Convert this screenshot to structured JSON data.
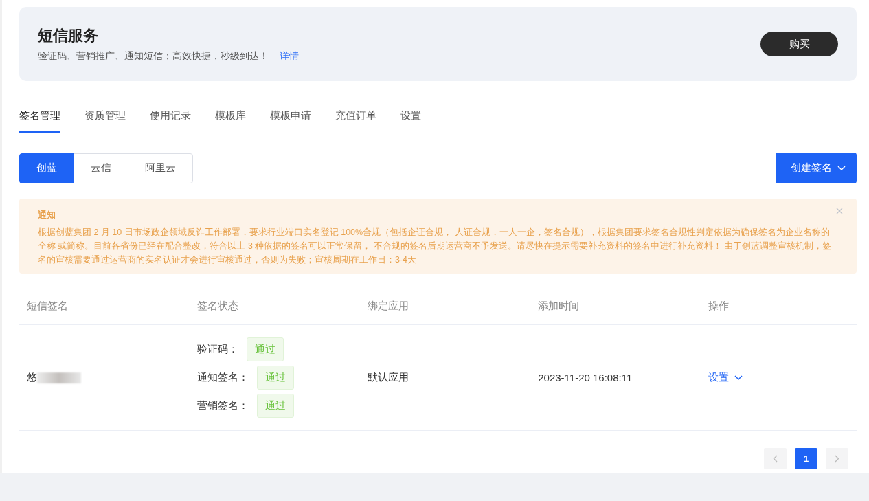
{
  "header": {
    "title": "短信服务",
    "subtitle": "验证码、营销推广、通知短信；高效快捷，秒级到达！",
    "link": "详情",
    "buy_button": "购买"
  },
  "tabs": [
    {
      "label": "签名管理",
      "selected": true
    },
    {
      "label": "资质管理",
      "selected": false
    },
    {
      "label": "使用记录",
      "selected": false
    },
    {
      "label": "模板库",
      "selected": false
    },
    {
      "label": "模板申请",
      "selected": false
    },
    {
      "label": "充值订单",
      "selected": false
    },
    {
      "label": "设置",
      "selected": false
    }
  ],
  "providers": [
    {
      "label": "创蓝",
      "selected": true
    },
    {
      "label": "云信",
      "selected": false
    },
    {
      "label": "阿里云",
      "selected": false
    }
  ],
  "create_button": "创建签名",
  "notice": {
    "title": "通知",
    "text": "根据创蓝集团 2 月 10 日市场政企领域反诈工作部署，要求行业端口实名登记 100%合规（包括企证合规， 人证合规，一人一企，签名合规），根据集团要求签名合规性判定依据为确保签名为企业名称的全称 或简称。目前各省份已经在配合整改，符合以上 3 种依据的签名可以正常保留， 不合规的签名后期运营商不予发送。请尽快在提示需要补充资料的签名中进行补充资料！ 由于创蓝调整审核机制，签名的审核需要通过运营商的实名认证才会进行审核通过，否则为失败；审核周期在工作日：3-4天"
  },
  "table": {
    "columns": [
      "短信签名",
      "签名状态",
      "绑定应用",
      "添加时间",
      "操作"
    ],
    "rows": [
      {
        "signature": "悠",
        "statuses": [
          {
            "label": "验证码：",
            "status": "通过"
          },
          {
            "label": "通知签名：",
            "status": "通过"
          },
          {
            "label": "营销签名：",
            "status": "通过"
          }
        ],
        "app": "默认应用",
        "time": "2023-11-20 16:08:11",
        "action": "设置"
      }
    ]
  },
  "pagination": {
    "pages": [
      {
        "label": "1",
        "selected": true
      }
    ]
  }
}
